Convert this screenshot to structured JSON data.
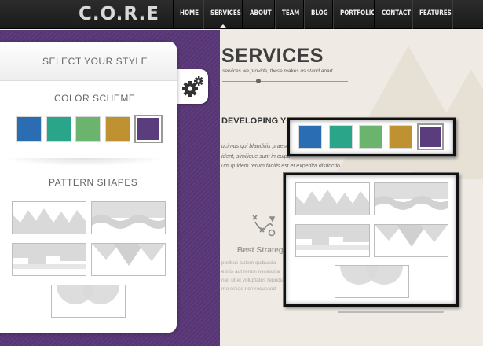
{
  "header": {
    "logo": "C.O.R.E",
    "nav": [
      "HOME",
      "SERVICES",
      "ABOUT",
      "TEAM",
      "BLOG",
      "PORTFOLIO",
      "CONTACT",
      "FEATURES"
    ],
    "active_nav": "SERVICES"
  },
  "page": {
    "title": "SERVICES",
    "subtitle": "services we provide, these makes us stand apart.",
    "section_heading": "DEVELOPING YOU",
    "body_lines": [
      "ucimus qui blanditiis praese",
      "ident, similique sunt in culpa",
      "um quidem rerum facilis est et expedita distinctio."
    ],
    "feature": {
      "icon": "strategy-diagram-icon",
      "title": "Best Strategi",
      "lines": [
        "poribus autem quibusda",
        "ebitis aut rerum necessita",
        "niet ut et voluptates repudian",
        "molestiae non recusand"
      ]
    }
  },
  "style_switcher": {
    "title": "SELECT YOUR STYLE",
    "toggle_icon": "gears-icon",
    "color_scheme": {
      "title": "COLOR SCHEME",
      "swatches": [
        {
          "name": "blue",
          "color": "#2a6db3"
        },
        {
          "name": "teal",
          "color": "#2aa58a"
        },
        {
          "name": "green",
          "color": "#6bb46e"
        },
        {
          "name": "gold",
          "color": "#bf9131"
        },
        {
          "name": "purple",
          "color": "#5a3d7c"
        }
      ],
      "selected": "purple"
    },
    "pattern_shapes": {
      "title": "PATTERN SHAPES",
      "patterns": [
        "peaks-pattern",
        "waves-pattern",
        "steps-pattern",
        "triangles-pattern",
        "circles-pattern"
      ]
    }
  },
  "colors": {
    "nav_bg": "#1f1f1f",
    "switcher_bg": "#5a3a78",
    "page_bg": "#efebe4"
  }
}
